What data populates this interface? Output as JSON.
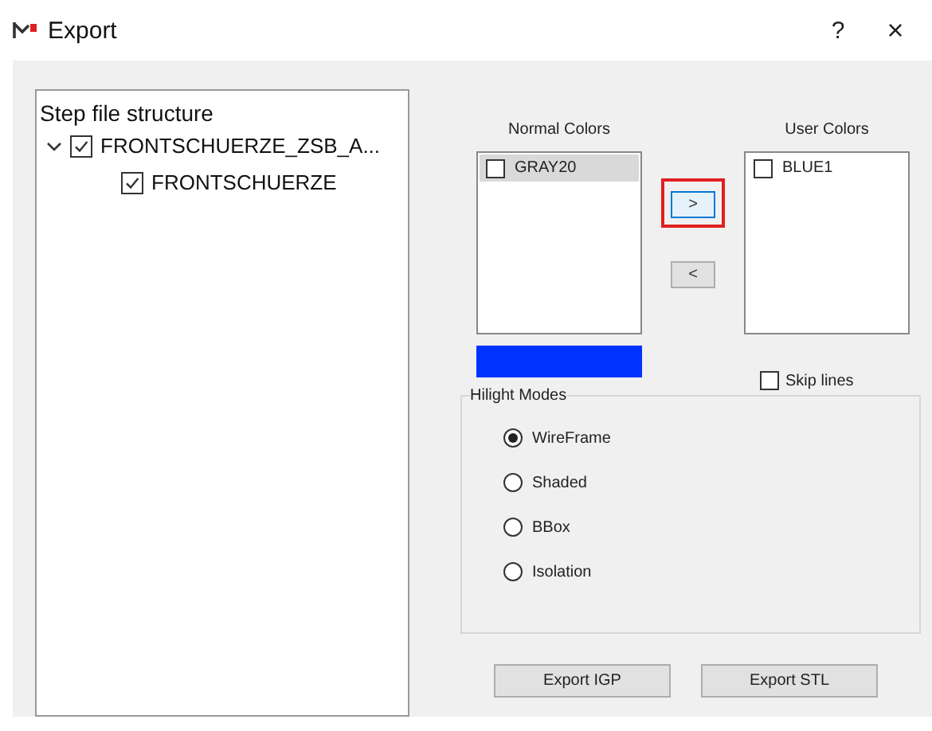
{
  "window": {
    "title": "Export",
    "help": "?",
    "close": "×"
  },
  "tree": {
    "title": "Step file structure",
    "items": [
      {
        "label": "FRONTSCHUERZE_ZSB_A...",
        "checked": true,
        "expanded": true,
        "children": [
          {
            "label": "FRONTSCHUERZE",
            "checked": true
          }
        ]
      }
    ]
  },
  "normal_colors": {
    "title": "Normal Colors",
    "items": [
      {
        "label": "GRAY20",
        "checked": false,
        "selected": true
      }
    ]
  },
  "user_colors": {
    "title": "User Colors",
    "items": [
      {
        "label": "BLUE1",
        "checked": false,
        "selected": false
      }
    ]
  },
  "move_buttons": [
    {
      "label": ">",
      "highlighted": true,
      "focused": true
    },
    {
      "label": "<",
      "highlighted": false,
      "focused": false
    }
  ],
  "color_swatch": {
    "color": "#0033ff"
  },
  "skip_lines": {
    "label": "Skip lines",
    "checked": false
  },
  "hilight_modes": {
    "title": "Hilight Modes",
    "options": [
      {
        "label": "WireFrame",
        "selected": true
      },
      {
        "label": "Shaded",
        "selected": false
      },
      {
        "label": "BBox",
        "selected": false
      },
      {
        "label": "Isolation",
        "selected": false
      }
    ]
  },
  "buttons": [
    "Export IGP",
    "Export STL"
  ]
}
